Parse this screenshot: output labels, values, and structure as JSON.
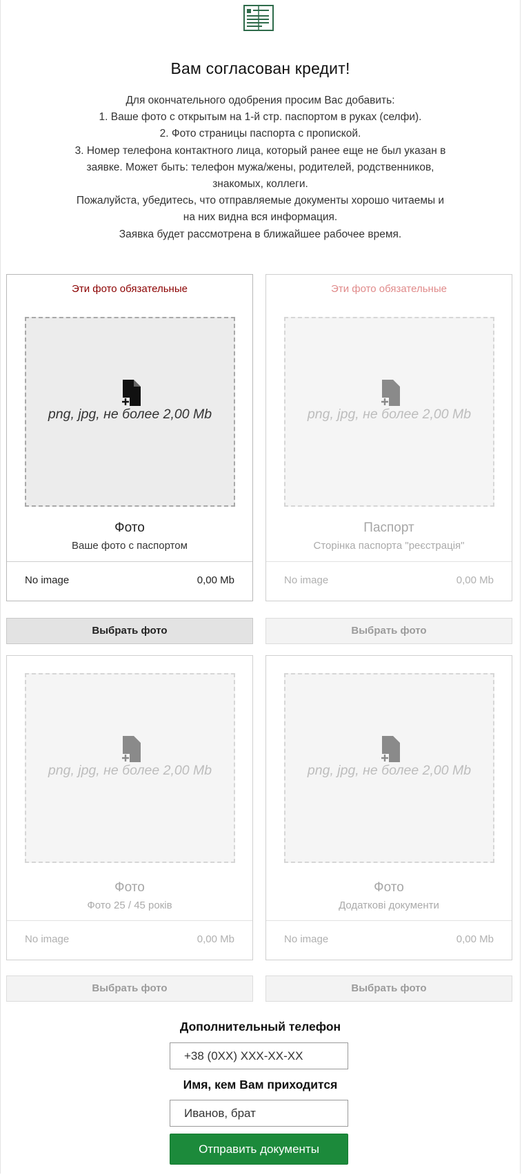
{
  "header": {
    "icon": "document-list-icon",
    "title": "Вам согласован кредит!"
  },
  "instructions": {
    "lines": [
      "Для окончательного одобрения просим Вас добавить:",
      "1. Ваше фото с открытым на 1-й стр. паспортом в руках (селфи).",
      "2. Фото страницы паспорта с пропиской.",
      "3. Номер телефона контактного лица, который ранее еще не был указан в",
      "заявке. Может быть: телефон мужа/жены, родителей, родственников,",
      "знакомых, коллеги.",
      "Пожалуйста, убедитесь, что отправляемые документы хорошо читаемы и",
      "на них видна вся информация.",
      "Заявка будет рассмотрена в ближайшее рабочее время."
    ]
  },
  "uploads": [
    {
      "required_label": "Эти фото обязательные",
      "hint": "png, jpg, не более 2,00 Mb",
      "name": "Фото",
      "subtitle": "Ваше фото с паспортом",
      "file_name": "No image",
      "file_size": "0,00 Mb",
      "button": "Выбрать фото"
    },
    {
      "required_label": "Эти фото обязательные",
      "hint": "png, jpg, не более 2,00 Mb",
      "name": "Паспорт",
      "subtitle": "Сторінка паспорта \"реєстрація\"",
      "file_name": "No image",
      "file_size": "0,00 Mb",
      "button": "Выбрать фото"
    },
    {
      "hint": "png, jpg, не более 2,00 Mb",
      "name": "Фото",
      "subtitle": "Фото 25 / 45 років",
      "file_name": "No image",
      "file_size": "0,00 Mb",
      "button": "Выбрать фото"
    },
    {
      "hint": "png, jpg, не более 2,00 Mb",
      "name": "Фото",
      "subtitle": "Додаткові документи",
      "file_name": "No image",
      "file_size": "0,00 Mb",
      "button": "Выбрать фото"
    }
  ],
  "form": {
    "phone_label": "Дополнительный телефон",
    "phone_placeholder": "+38 (0XX) XXX-XX-XX",
    "relation_label": "Имя, кем Вам приходится",
    "relation_placeholder": "Иванов, брат",
    "submit": "Отправить документы"
  },
  "colors": {
    "accent_green": "#1c8a3b",
    "required_red": "#8b0000",
    "icon_green": "#2e6b4a"
  }
}
